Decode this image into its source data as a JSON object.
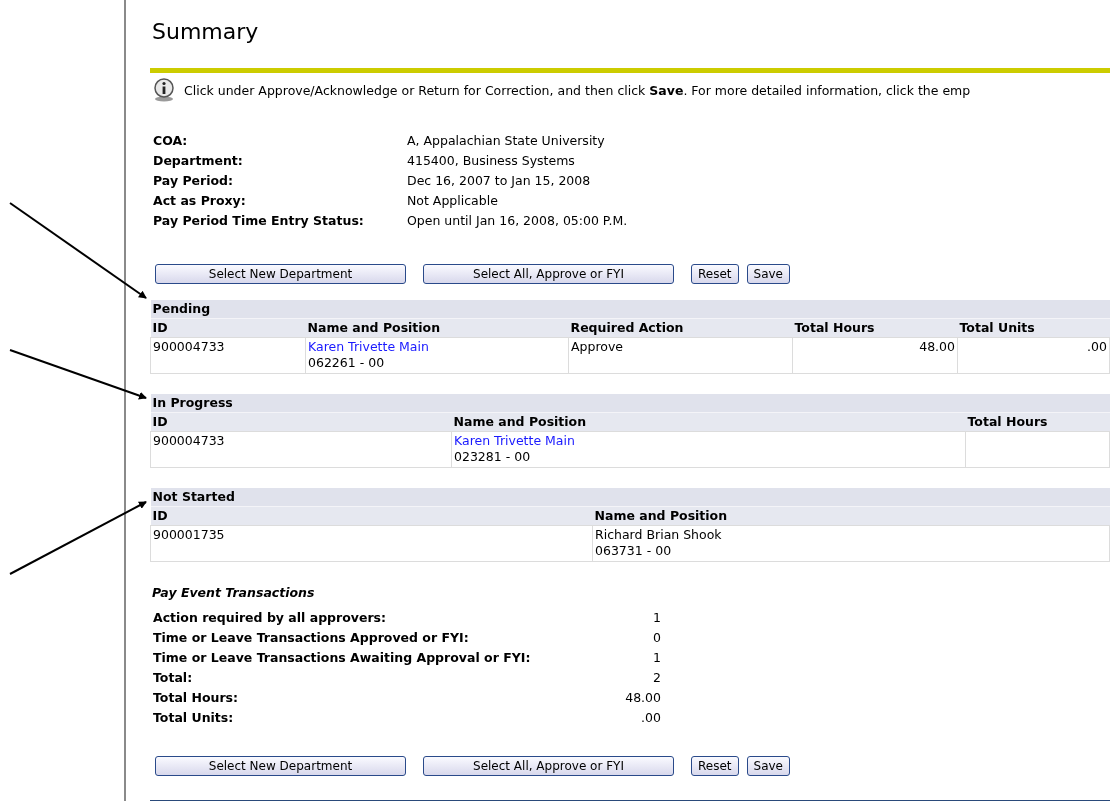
{
  "title": "Summary",
  "info": "Click under Approve/Acknowledge or Return for Correction, and then click **Save**. For more detailed information, click the emp",
  "details": [
    {
      "label": "COA:",
      "value": "A, Appalachian State University"
    },
    {
      "label": "Department:",
      "value": "415400, Business Systems"
    },
    {
      "label": "Pay Period:",
      "value": "Dec 16, 2007 to Jan 15, 2008"
    },
    {
      "label": "Act as Proxy:",
      "value": "Not Applicable"
    },
    {
      "label": "Pay Period Time Entry Status:",
      "value": "Open until Jan 16, 2008, 05:00 P.M."
    }
  ],
  "top_buttons": [
    {
      "label": "Select New Department",
      "kind": "wide"
    },
    {
      "label": "Select All, Approve or FYI",
      "kind": "wide"
    },
    {
      "label": "Reset",
      "kind": "plain"
    },
    {
      "label": "Save",
      "kind": "plain"
    }
  ],
  "sections": [
    {
      "title": "Pending",
      "columns": [
        "ID",
        "Name and Position",
        "Required Action",
        "Total Hours",
        "Total Units"
      ],
      "rows": [
        [
          {
            "kind": "text",
            "text": "900004733"
          },
          {
            "kind": "person",
            "name": "Karen Trivette Main",
            "position": "062261 - 00",
            "link": true
          },
          {
            "kind": "text",
            "text": "Approve"
          },
          {
            "kind": "number",
            "text": "48.00"
          },
          {
            "kind": "number",
            "text": ".00"
          }
        ]
      ]
    },
    {
      "title": "In Progress",
      "columns": [
        "ID",
        "Name and Position",
        "Total Hours"
      ],
      "rows": [
        [
          {
            "kind": "text",
            "text": "900004733"
          },
          {
            "kind": "person",
            "name": "Karen Trivette Main",
            "position": "023281 - 00",
            "link": true
          },
          {
            "kind": "empty"
          }
        ]
      ]
    },
    {
      "title": "Not Started",
      "columns": [
        "ID",
        "Name and Position"
      ],
      "rows": [
        [
          {
            "kind": "text",
            "text": "900001735"
          },
          {
            "kind": "person",
            "name": "Richard Brian Shook",
            "position": "063731 - 00",
            "link": false
          }
        ]
      ]
    }
  ],
  "transactions": {
    "title": "Pay Event Transactions",
    "rows": [
      {
        "label": "Action required by all approvers:",
        "value": "1"
      },
      {
        "label": "Time or Leave Transactions Approved or FYI:",
        "value": "0"
      },
      {
        "label": "Time or Leave Transactions Awaiting Approval or FYI:",
        "value": "1"
      },
      {
        "label": "Total:",
        "value": "2"
      },
      {
        "label": "Total Hours:",
        "value": "48.00"
      },
      {
        "label": "Total Units:",
        "value": ".00"
      }
    ]
  },
  "bottom_buttons": [
    {
      "label": "Select New Department",
      "kind": "wide"
    },
    {
      "label": "Select All, Approve or FYI",
      "kind": "wide"
    },
    {
      "label": "Reset",
      "kind": "plain"
    },
    {
      "label": "Save",
      "kind": "plain"
    }
  ]
}
